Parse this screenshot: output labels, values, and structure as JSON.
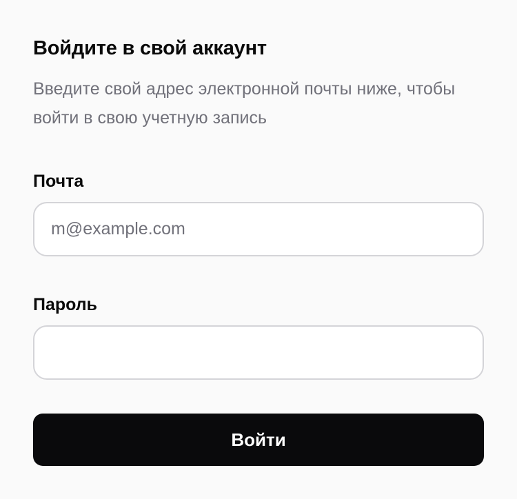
{
  "login": {
    "title": "Войдите в свой аккаунт",
    "subtitle": "Введите свой адрес электронной почты ниже, чтобы войти в свою учетную запись",
    "email": {
      "label": "Почта",
      "placeholder": "m@example.com",
      "value": ""
    },
    "password": {
      "label": "Пароль",
      "placeholder": "",
      "value": ""
    },
    "submit_label": "Войти"
  },
  "colors": {
    "background": "#fafafa",
    "text": "#0a0a0a",
    "muted_text": "#71717a",
    "input_border": "#d4d4d8",
    "button_bg": "#0a0a0c",
    "button_text": "#ffffff"
  }
}
